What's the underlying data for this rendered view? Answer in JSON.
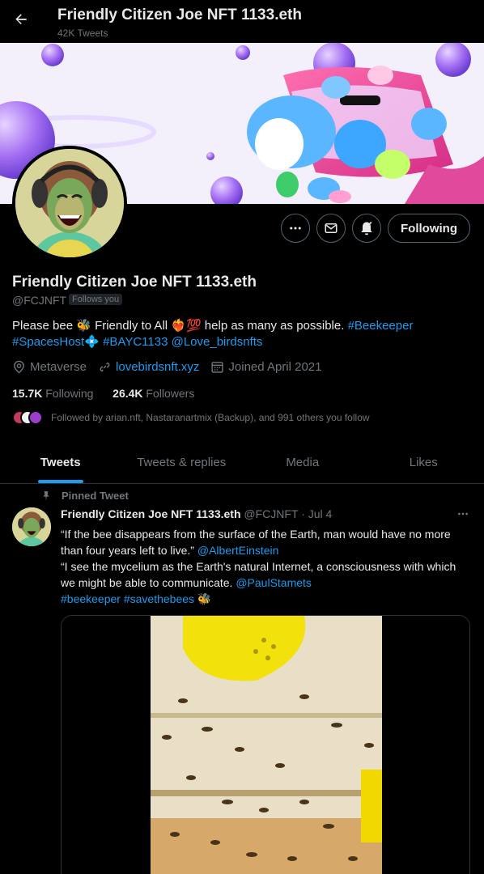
{
  "header": {
    "back_icon": "arrow-left-icon",
    "title": "Friendly Citizen Joe NFT 1133.eth",
    "subtitle": "42K Tweets"
  },
  "profile": {
    "name": "Friendly Citizen Joe NFT 1133.eth",
    "handle": "@FCJNFT",
    "follows_you": "Follows you",
    "bio": {
      "part1": "Please bee 🐝 Friendly to All ❤️‍🔥💯 help as many as possible. ",
      "hashtag1": "#Beekeeper",
      "hashtag2": "#SpacesHost",
      "sparkle": "💠 ",
      "hashtag3": "#BAYC1133",
      "mention1": "@Love_birdsnfts"
    },
    "location": "Metaverse",
    "website": "lovebirdsnft.xyz",
    "joined": "Joined April 2021",
    "following_count": "15.7K",
    "following_label": "Following",
    "followers_count": "26.4K",
    "followers_label": "Followers",
    "followed_by": "Followed by arian.nft, Nastaranartmix (Backup), and 991 others you follow"
  },
  "actions": {
    "more_icon": "more-icon",
    "message_icon": "mail-icon",
    "notify_icon": "bell-icon",
    "following_label": "Following"
  },
  "tabs": [
    {
      "label": "Tweets",
      "active": true
    },
    {
      "label": "Tweets & replies",
      "active": false
    },
    {
      "label": "Media",
      "active": false
    },
    {
      "label": "Likes",
      "active": false
    }
  ],
  "tweet": {
    "pinned_label": "Pinned Tweet",
    "author": "Friendly Citizen Joe NFT 1133.eth",
    "handle": "@FCJNFT",
    "dot": "·",
    "date": "Jul 4",
    "line1": "“If the bee disappears from the surface of the Earth, man would have no more than four years left to live.” ",
    "mention1": "@AlbertEinstein",
    "line2": "“I see the mycelium as the Earth's natural Internet, a consciousness with which we might be able to communicate. ",
    "mention2": "@PaulStamets",
    "hashtag1": "#beekeeper",
    "hashtag2": "#savethebees",
    "emoji": " 🐝"
  },
  "colors": {
    "accent": "#1d9bf0",
    "background": "#000000",
    "muted": "#71767b",
    "border": "#2f3336"
  }
}
